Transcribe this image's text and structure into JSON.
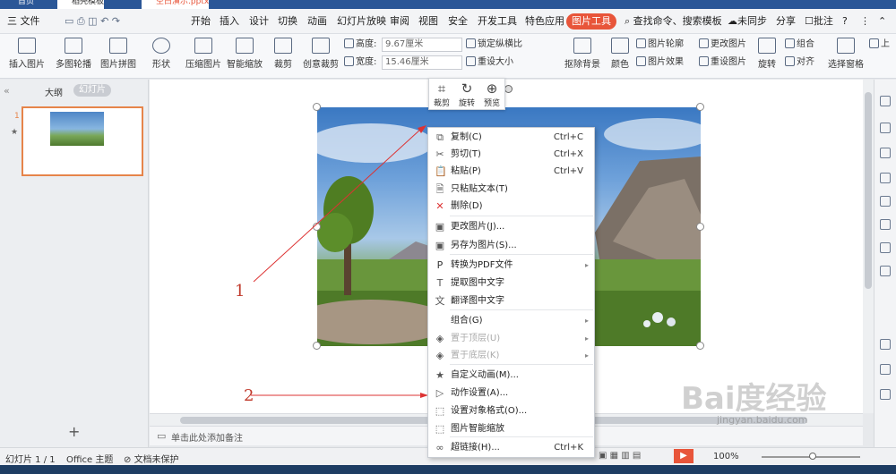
{
  "tabs": [
    "首页",
    "稻壳模板",
    "空白演示.pptx"
  ],
  "menu": [
    "三 文件",
    "开始",
    "插入",
    "设计",
    "切换",
    "动画",
    "幻灯片放映",
    "审阅",
    "视图",
    "安全",
    "开发工具",
    "特色应用",
    "图片工具",
    "查找命令、搜索模板",
    "未同步",
    "分享",
    "批注"
  ],
  "ribbon": {
    "big": [
      "插入图片",
      "多图轮播",
      "图片拼图",
      "形状",
      "压缩图片",
      "智能缩放",
      "裁剪",
      "创意裁剪",
      "抠除背景",
      "颜色",
      "旋转",
      "对齐",
      "选择窗格"
    ],
    "height_label": "高度:",
    "height_value": "9.67厘米",
    "width_label": "宽度:",
    "width_value": "15.46厘米",
    "lock_label": "锁定纵横比",
    "reset_label": "重设大小",
    "right": [
      "图片轮廓",
      "更改图片",
      "图片效果",
      "重设图片",
      "组合",
      "上"
    ]
  },
  "left_panel": {
    "tab_outline": "大纲",
    "tab_slides": "幻灯片",
    "slide_number": "1",
    "add_label": "+"
  },
  "mini_toolbar": [
    "裁剪",
    "旋转",
    "预览"
  ],
  "context_menu": [
    {
      "label": "复制(C)",
      "shortcut": "Ctrl+C",
      "icon": "copy-icon",
      "glyph": "⧉"
    },
    {
      "label": "剪切(T)",
      "shortcut": "Ctrl+X",
      "icon": "cut-icon",
      "glyph": "✂"
    },
    {
      "label": "粘贴(P)",
      "shortcut": "Ctrl+V",
      "icon": "paste-icon",
      "glyph": "📋"
    },
    {
      "label": "只粘贴文本(T)",
      "shortcut": "",
      "icon": "paste-text-icon",
      "glyph": "🗎"
    },
    {
      "label": "删除(D)",
      "shortcut": "",
      "icon": "delete-icon",
      "glyph": "✕"
    },
    {
      "label": "更改图片(J)...",
      "shortcut": "",
      "icon": "change-picture-icon",
      "glyph": "▣"
    },
    {
      "label": "另存为图片(S)...",
      "shortcut": "",
      "icon": "save-picture-icon",
      "glyph": "▣"
    },
    {
      "label": "转换为PDF文件",
      "shortcut": "",
      "icon": "pdf-icon",
      "glyph": "P",
      "arrow": true
    },
    {
      "label": "提取图中文字",
      "shortcut": "",
      "icon": "extract-text-icon",
      "glyph": "T"
    },
    {
      "label": "翻译图中文字",
      "shortcut": "",
      "icon": "translate-icon",
      "glyph": "文"
    },
    {
      "label": "组合(G)",
      "shortcut": "",
      "icon": "",
      "glyph": "",
      "arrow": true
    },
    {
      "label": "置于顶层(U)",
      "shortcut": "",
      "icon": "bring-front-icon",
      "glyph": "◈",
      "arrow": true,
      "disabled": true
    },
    {
      "label": "置于底层(K)",
      "shortcut": "",
      "icon": "send-back-icon",
      "glyph": "◈",
      "arrow": true,
      "disabled": true
    },
    {
      "label": "自定义动画(M)...",
      "shortcut": "",
      "icon": "animation-icon",
      "glyph": "★"
    },
    {
      "label": "动作设置(A)...",
      "shortcut": "",
      "icon": "action-icon",
      "glyph": "▷"
    },
    {
      "label": "设置对象格式(O)...",
      "shortcut": "",
      "icon": "format-icon",
      "glyph": "⬚"
    },
    {
      "label": "图片智能缩放",
      "shortcut": "",
      "icon": "smart-zoom-icon",
      "glyph": "⬚"
    },
    {
      "label": "超链接(H)...",
      "shortcut": "Ctrl+K",
      "icon": "link-icon",
      "glyph": "∞"
    }
  ],
  "annotations": [
    "1",
    "2"
  ],
  "notes_placeholder": "单击此处添加备注",
  "status": {
    "slide": "幻灯片 1 / 1",
    "theme": "Office 主题",
    "protect": "文档未保护",
    "zoom": "100%"
  },
  "watermark": {
    "main": "Bai度经验",
    "sub": "jingyan.baidu.com"
  }
}
